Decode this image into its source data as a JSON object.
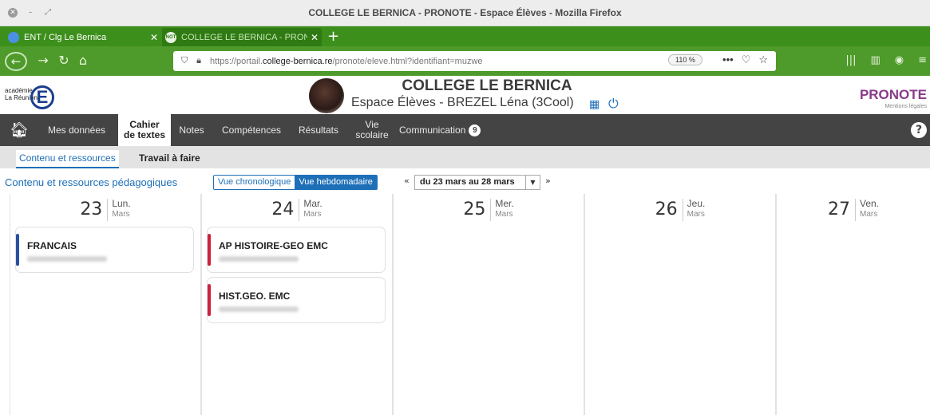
{
  "window": {
    "title": "COLLEGE LE BERNICA - PRONOTE - Espace Élèves - Mozilla Firefox"
  },
  "tabs": [
    {
      "label": "ENT / Clg Le Bernica"
    },
    {
      "label": "COLLEGE LE BERNICA - PRON"
    }
  ],
  "browser": {
    "url_prefix": "https://portail.",
    "url_domain": "college-bernica.re",
    "url_path": "/pronote/eleve.html?identifiant=muzwe",
    "zoom": "110 %"
  },
  "header": {
    "academie_line1": "académie",
    "academie_line2": "La Réunion",
    "academie_letter": "E",
    "school": "COLLEGE LE BERNICA",
    "espace": "Espace Élèves - BREZEL Léna (3Cool)",
    "brand": "PRONOTE",
    "mentions": "Mentions légales"
  },
  "menu": {
    "items": [
      {
        "label": "Mes données"
      },
      {
        "label1": "Cahier",
        "label2": "de textes"
      },
      {
        "label": "Notes"
      },
      {
        "label": "Compétences"
      },
      {
        "label": "Résultats"
      },
      {
        "label1": "Vie",
        "label2": "scolaire"
      },
      {
        "label": "Communication"
      }
    ],
    "communication_badge": "9",
    "help": "?"
  },
  "submenu": {
    "active": "Contenu et ressources",
    "other": "Travail à faire"
  },
  "toolbar": {
    "title": "Contenu et ressources pédagogiques",
    "view_chrono": "Vue chronologique",
    "view_weekly": "Vue hebdomadaire",
    "date_range": "du 23 mars au 28 mars"
  },
  "days": [
    {
      "num": "23",
      "name": "Lun.",
      "month": "Mars"
    },
    {
      "num": "24",
      "name": "Mar.",
      "month": "Mars"
    },
    {
      "num": "25",
      "name": "Mer.",
      "month": "Mars"
    },
    {
      "num": "26",
      "name": "Jeu.",
      "month": "Mars"
    },
    {
      "num": "27",
      "name": "Ven.",
      "month": "Mars"
    }
  ],
  "courses": [
    {
      "title": "FRANCAIS",
      "color": "#2a4f9c"
    },
    {
      "title": "AP HISTOIRE-GEO EMC",
      "color": "#d0213a"
    },
    {
      "title": "HIST.GEO. EMC",
      "color": "#d0213a"
    }
  ],
  "colors": {
    "firefox_green": "#4e9a2a",
    "menu_bg": "#444444",
    "accent_blue": "#1d6fb8"
  },
  "icons": [
    "back-icon",
    "forward-icon",
    "reload-icon",
    "home-icon",
    "shield-icon",
    "lock-icon",
    "more-icon",
    "pocket-icon",
    "star-icon",
    "library-icon",
    "sidebar-icon",
    "account-icon",
    "qr-code-icon",
    "power-icon",
    "help-icon"
  ]
}
